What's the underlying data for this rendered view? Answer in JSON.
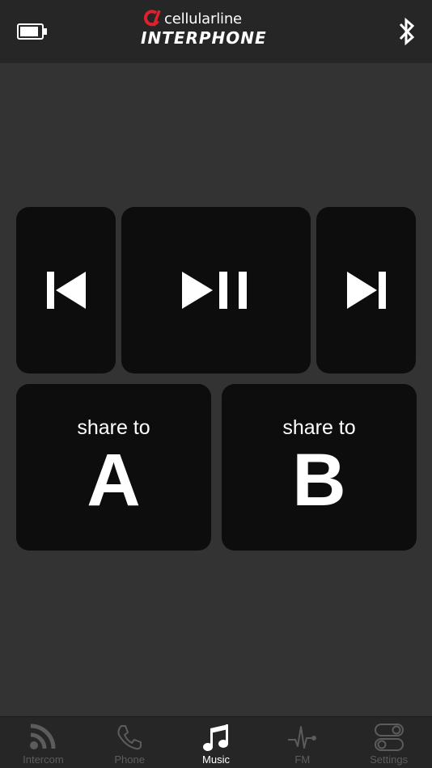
{
  "header": {
    "brand": "cellularline",
    "product": "INTERPHONE",
    "icons": {
      "battery": "battery-icon",
      "bluetooth": "bluetooth-icon"
    }
  },
  "controls": {
    "previous": {
      "icon": "skip-previous-icon"
    },
    "play_pause": {
      "icon": "play-pause-icon"
    },
    "next": {
      "icon": "skip-next-icon"
    }
  },
  "share": {
    "a": {
      "caption": "share to",
      "target": "A"
    },
    "b": {
      "caption": "share to",
      "target": "B"
    }
  },
  "tabs": [
    {
      "label": "Intercom",
      "icon": "intercom-icon",
      "active": false
    },
    {
      "label": "Phone",
      "icon": "phone-icon",
      "active": false
    },
    {
      "label": "Music",
      "icon": "music-note-icon",
      "active": true
    },
    {
      "label": "FM",
      "icon": "fm-wave-icon",
      "active": false
    },
    {
      "label": "Settings",
      "icon": "settings-toggles-icon",
      "active": false
    }
  ],
  "colors": {
    "background": "#333333",
    "bars": "#262626",
    "button": "#0d0d0d",
    "brand_red": "#e0202a",
    "inactive_tab": "#5c5c5c",
    "active_tab": "#ffffff"
  }
}
